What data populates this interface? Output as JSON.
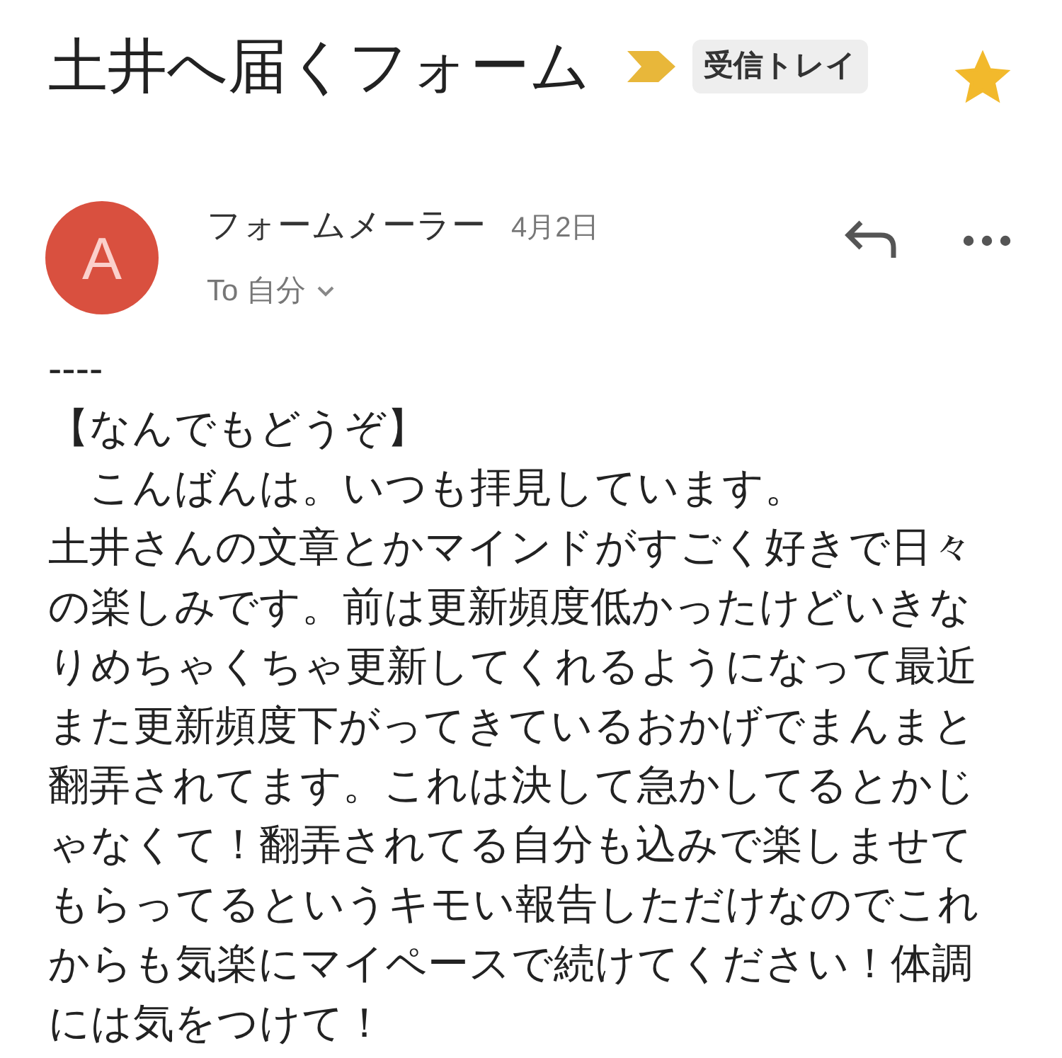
{
  "subject": "土井へ届くフォーム",
  "important": true,
  "label": "受信トレイ",
  "starred": true,
  "message": {
    "avatar": "A",
    "sender": "フォームメーラー",
    "date": "4月2日",
    "to": "To 自分"
  },
  "body": [
    "----",
    "【なんでもどうぞ】",
    "　こんばんは。いつも拝見しています。",
    "土井さんの文章とかマインドがすごく好きで日々の楽しみです。前は更新頻度低かったけどいきなりめちゃくちゃ更新してくれるようになって最近また更新頻度下がってきているおかげでまんまと翻弄されてます。これは決して急かしてるとかじゃなくて！翻弄されてる自分も込みで楽しませてもらってるというキモい報告しただけなのでこれからも気楽にマイペースで続けてください！体調には気をつけて！"
  ]
}
